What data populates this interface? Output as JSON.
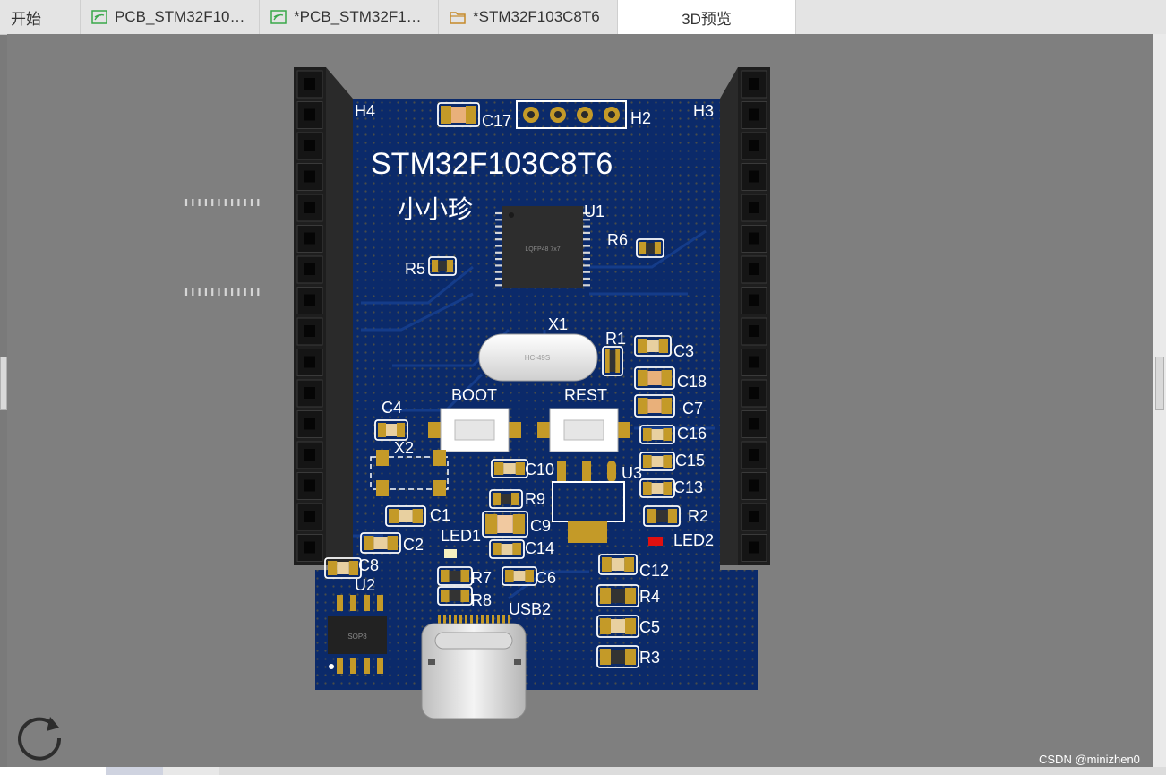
{
  "tabs": [
    {
      "label": "开始",
      "icon": "none"
    },
    {
      "label": "PCB_STM32F10…",
      "icon": "pcb-file-icon"
    },
    {
      "label": "*PCB_STM32F1…",
      "icon": "pcb-file-icon"
    },
    {
      "label": "*STM32F103C8T6",
      "icon": "folder-icon"
    },
    {
      "label": "3D预览",
      "icon": "none"
    }
  ],
  "board": {
    "title": "STM32F103C8T6",
    "author": "小小珍",
    "chip_marking": "LQFP48 7x7",
    "crystal_marking": "HC-49S",
    "sop_marking": "SOP8",
    "labels": {
      "H4": "H4",
      "H3": "H3",
      "H2": "H2",
      "C17": "C17",
      "U1": "U1",
      "R6": "R6",
      "R5": "R5",
      "X1": "X1",
      "R1": "R1",
      "C3": "C3",
      "C18": "C18",
      "C7": "C7",
      "BOOT": "BOOT",
      "REST": "REST",
      "C4": "C4",
      "X2": "X2",
      "C16": "C16",
      "C15": "C15",
      "C13": "C13",
      "C10": "C10",
      "U3": "U3",
      "R9": "R9",
      "C9": "C9",
      "R2": "R2",
      "C1": "C1",
      "LED1": "LED1",
      "LED2": "LED2",
      "C2": "C2",
      "C14": "C14",
      "C8": "C8",
      "R7": "R7",
      "C6": "C6",
      "C12": "C12",
      "U2": "U2",
      "R8": "R8",
      "USB2": "USB2",
      "R4": "R4",
      "C5": "C5",
      "R3": "R3"
    }
  },
  "watermark": "CSDN @minizhen0",
  "colors": {
    "pcb": "#0b2a6a",
    "pad": "#c49a28",
    "silk": "#ffffff",
    "header": "#1a1a1a"
  }
}
